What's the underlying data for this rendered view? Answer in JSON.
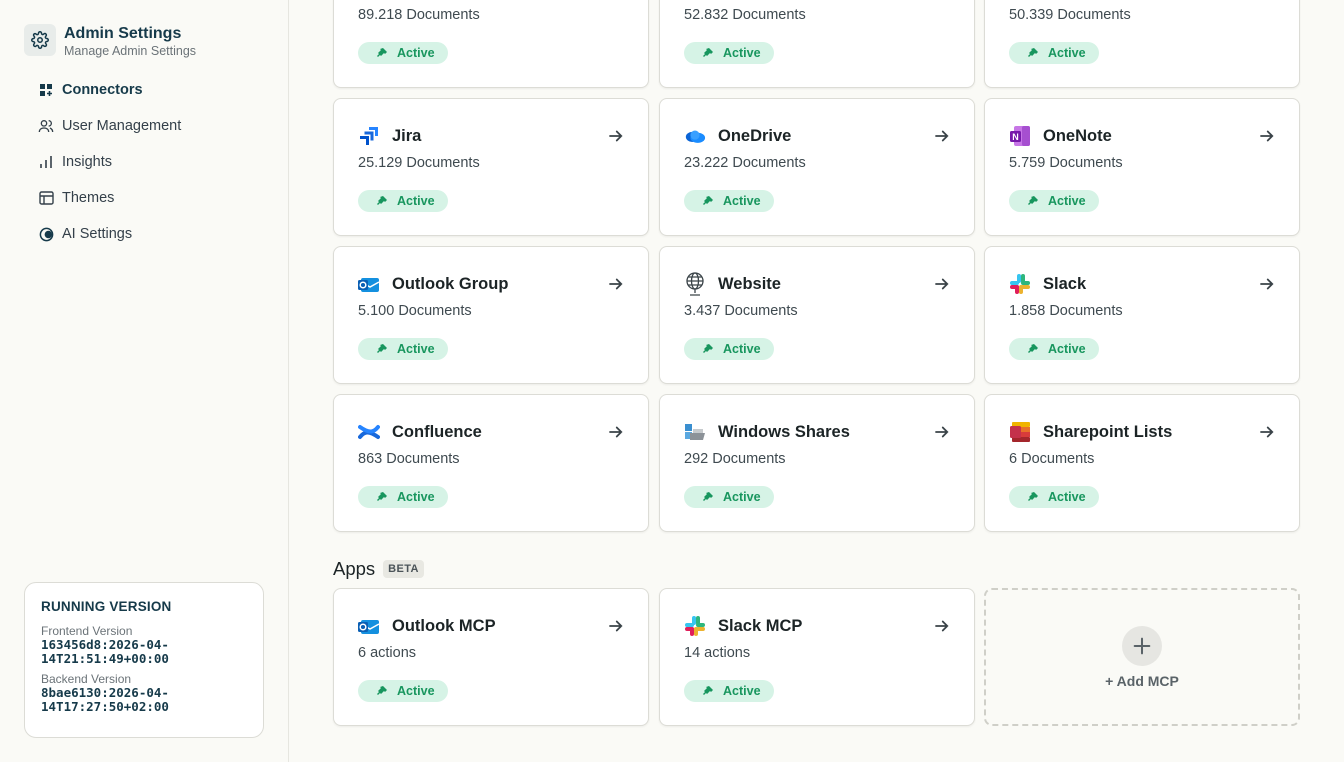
{
  "sidebar": {
    "title": "Admin Settings",
    "subtitle": "Manage Admin Settings",
    "nav": [
      {
        "label": "Connectors",
        "icon": "grid-icon",
        "active": true
      },
      {
        "label": "User Management",
        "icon": "users-icon"
      },
      {
        "label": "Insights",
        "icon": "bar-chart-icon"
      },
      {
        "label": "Themes",
        "icon": "palette-icon"
      },
      {
        "label": "AI Settings",
        "icon": "ai-icon"
      }
    ],
    "version": {
      "title": "RUNNING VERSION",
      "frontend_label": "Frontend Version",
      "frontend_value": "163456d8:2026-04-\n14T21:51:49+00:00",
      "backend_label": "Backend Version",
      "backend_value": "8bae6130:2026-04-\n14T17:27:50+02:00"
    }
  },
  "status_label": "Active",
  "connectors": [
    {
      "name": "",
      "count": "89.218 Documents",
      "icon": "connector-icon"
    },
    {
      "name": "",
      "count": "52.832 Documents",
      "icon": "connector-icon"
    },
    {
      "name": "",
      "count": "50.339 Documents",
      "icon": "connector-icon"
    },
    {
      "name": "Jira",
      "count": "25.129 Documents",
      "icon": "jira-icon"
    },
    {
      "name": "OneDrive",
      "count": "23.222 Documents",
      "icon": "onedrive-icon"
    },
    {
      "name": "OneNote",
      "count": "5.759 Documents",
      "icon": "onenote-icon"
    },
    {
      "name": "Outlook Group",
      "count": "5.100 Documents",
      "icon": "outlook-icon"
    },
    {
      "name": "Website",
      "count": "3.437 Documents",
      "icon": "globe-icon"
    },
    {
      "name": "Slack",
      "count": "1.858 Documents",
      "icon": "slack-icon"
    },
    {
      "name": "Confluence",
      "count": "863 Documents",
      "icon": "confluence-icon"
    },
    {
      "name": "Windows Shares",
      "count": "292 Documents",
      "icon": "windows-shares-icon"
    },
    {
      "name": "Sharepoint Lists",
      "count": "6 Documents",
      "icon": "sharepoint-lists-icon"
    }
  ],
  "apps": {
    "title": "Apps",
    "badge": "BETA",
    "items": [
      {
        "name": "Outlook MCP",
        "count": "6 actions",
        "icon": "outlook-icon"
      },
      {
        "name": "Slack MCP",
        "count": "14 actions",
        "icon": "slack-icon"
      }
    ],
    "add_label": "+ Add MCP"
  },
  "colors": {
    "accent": "#163a4a",
    "active_bg": "#d6f3e6",
    "active_text": "#18965e"
  }
}
